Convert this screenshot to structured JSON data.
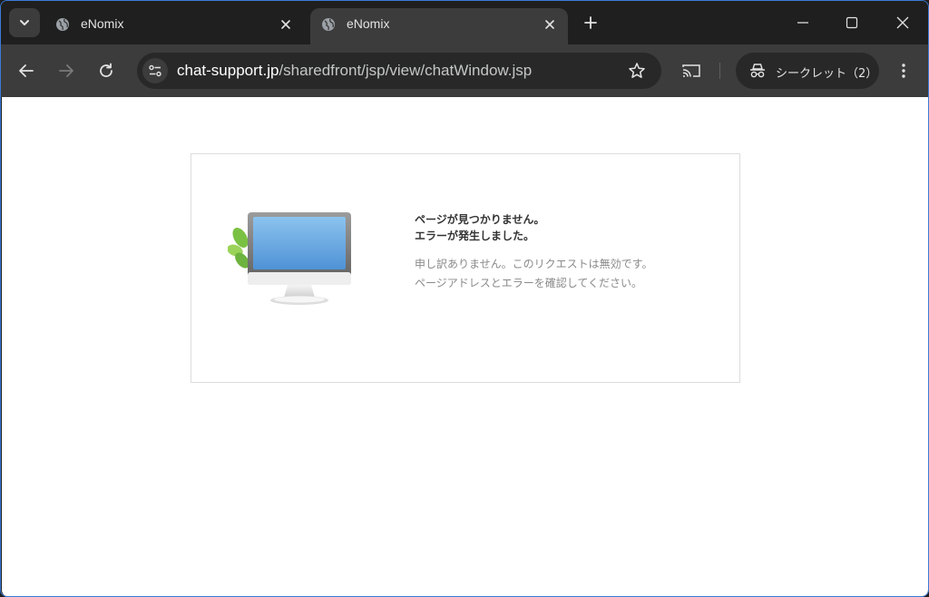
{
  "tabs": [
    {
      "title": "eNomix",
      "active": false
    },
    {
      "title": "eNomix",
      "active": true
    }
  ],
  "toolbar": {
    "url_host": "chat-support.jp",
    "url_path": "/sharedfront/jsp/view/chatWindow.jsp",
    "incognito_label": "シークレット（2）"
  },
  "error": {
    "heading_line1": "ページが見つかりません。",
    "heading_line2": "エラーが発生しました。",
    "body_line1": "申し訳ありません。このリクエストは無効です。",
    "body_line2": "ページアドレスとエラーを確認してください。"
  },
  "icons": {
    "tab_search": "chevron-down-icon",
    "favicon": "globe-icon",
    "close": "close-icon",
    "new_tab": "plus-icon",
    "minimize": "minimize-icon",
    "maximize": "maximize-icon",
    "window_close": "close-icon",
    "back": "arrow-left-icon",
    "forward": "arrow-right-icon",
    "reload": "reload-icon",
    "site_info": "tune-icon",
    "bookmark": "star-icon",
    "cast": "cast-icon",
    "incognito": "incognito-icon",
    "menu": "kebab-menu-icon"
  },
  "colors": {
    "frame": "#1f1f1f",
    "toolbar": "#3c3c3c",
    "omnibox": "#282828",
    "page": "#ffffff"
  }
}
